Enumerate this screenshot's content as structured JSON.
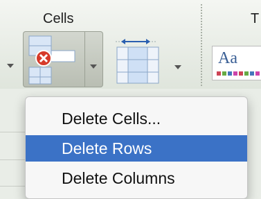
{
  "ribbon": {
    "cells_group_label": "Cells",
    "themes_group_label_partial": "T",
    "delete_button_icon": "delete-cells-icon",
    "format_button_icon": "format-cells-icon",
    "styles_icon_text": "Aa"
  },
  "menu": {
    "items": [
      {
        "label": "Delete Cells...",
        "selected": false
      },
      {
        "label": "Delete Rows",
        "selected": true
      },
      {
        "label": "Delete Columns",
        "selected": false
      }
    ]
  },
  "colors": {
    "selection": "#3b72c6",
    "delete_badge": "#d63a2a"
  }
}
